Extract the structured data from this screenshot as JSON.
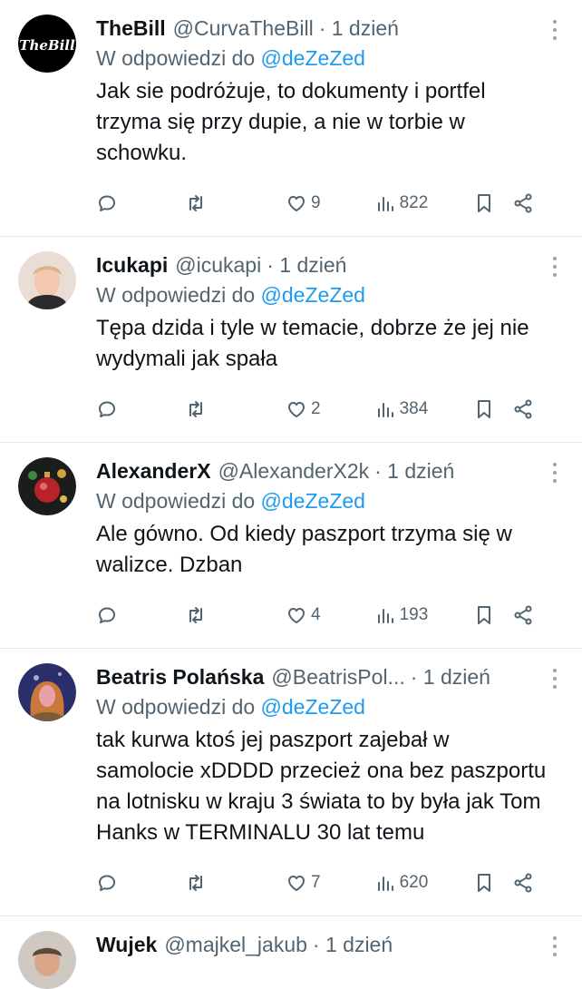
{
  "reply_prefix": "W odpowiedzi do",
  "tweets": [
    {
      "display_name": "TheBill",
      "handle": "@CurvaTheBill",
      "time": "· 1 dzień",
      "reply_to": "@deZeZed",
      "text": "Jak sie podróżuje, to dokumenty i portfel trzyma się przy dupie, a nie w torbie w schowku.",
      "likes": "9",
      "views": "822",
      "avatar": "thebill-logo",
      "avatar_text": "TheBill"
    },
    {
      "display_name": "Icukapi",
      "handle": "@icukapi",
      "time": "· 1 dzień",
      "reply_to": "@deZeZed",
      "text": "Tępa dzida i tyle w temacie, dobrze że jej nie wydymali jak spała",
      "likes": "2",
      "views": "384",
      "avatar": "portrait-photo"
    },
    {
      "display_name": "AlexanderX",
      "handle": "@AlexanderX2k",
      "time": "· 1 dzień",
      "reply_to": "@deZeZed",
      "text": "Ale gówno. Od kiedy paszport trzyma się w walizce. Dzban",
      "likes": "4",
      "views": "193",
      "avatar": "christmas-ornament-photo"
    },
    {
      "display_name": "Beatris Polańska",
      "handle": "@BeatrisPol...",
      "time": "· 1 dzień",
      "reply_to": "@deZeZed",
      "text": "tak kurwa ktoś jej paszport zajebał w samolocie xDDDD przecież ona bez paszportu na lotnisku w kraju 3 świata to by była jak Tom Hanks w TERMINALU 30 lat temu",
      "likes": "7",
      "views": "620",
      "avatar": "curly-hair-photo"
    },
    {
      "display_name": "Wujek",
      "handle": "@majkel_jakub",
      "time": "· 1 dzień",
      "reply_to": "",
      "text": "",
      "likes": "",
      "views": "",
      "avatar": "portrait-photo"
    }
  ],
  "colors": {
    "link": "#1d9bf0",
    "secondary_text": "#536471",
    "divider": "#e6e9ec"
  }
}
